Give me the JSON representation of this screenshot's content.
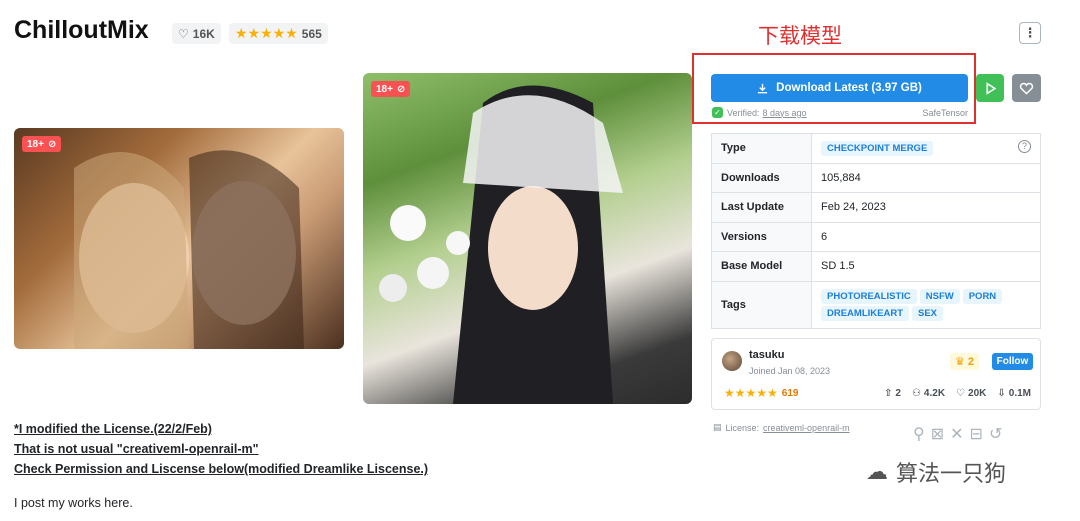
{
  "header": {
    "title": "ChilloutMix",
    "likes": "16K",
    "rating_stars": "★★★★★",
    "rating_count": "565",
    "annotation": "下载模型"
  },
  "download": {
    "label": "Download Latest (3.97 GB)",
    "verified_label": "Verified:",
    "verified_time": "8 days ago",
    "format": "SafeTensor"
  },
  "details": {
    "rows": [
      {
        "key": "Type",
        "value": "CHECKPOINT MERGE"
      },
      {
        "key": "Downloads",
        "value": "105,884"
      },
      {
        "key": "Last Update",
        "value": "Feb 24, 2023"
      },
      {
        "key": "Versions",
        "value": "6"
      },
      {
        "key": "Base Model",
        "value": "SD 1.5"
      }
    ],
    "tags_key": "Tags",
    "tags": [
      "PHOTOREALISTIC",
      "NSFW",
      "PORN",
      "DREAMLIKEART",
      "SEX"
    ]
  },
  "creator": {
    "name": "tasuku",
    "joined": "Joined Jan 08, 2023",
    "crown_count": "2",
    "follow_label": "Follow",
    "stars": "★★★★★",
    "rating_count": "619",
    "uploads": "2",
    "followers": "4.2K",
    "favorites": "20K",
    "downloads": "0.1M"
  },
  "license": {
    "label": "License:",
    "name": "creativeml-openrail-m"
  },
  "images": [
    {
      "badge": "18+"
    },
    {
      "badge": "18+"
    }
  ],
  "description": {
    "line1": "*I modified the License.(22/2/Feb)",
    "line2": "That is not usual \"creativeml-openrail-m\"",
    "line3": "Check Permission and Liscense below(modified Dreamlike Liscense.)",
    "line4": "I post my works here."
  },
  "watermark": "算法一只狗",
  "colors": {
    "primary": "#228be6",
    "success": "#40c057",
    "danger": "#fa5252",
    "annotation": "#e03131",
    "star": "#fab005"
  }
}
